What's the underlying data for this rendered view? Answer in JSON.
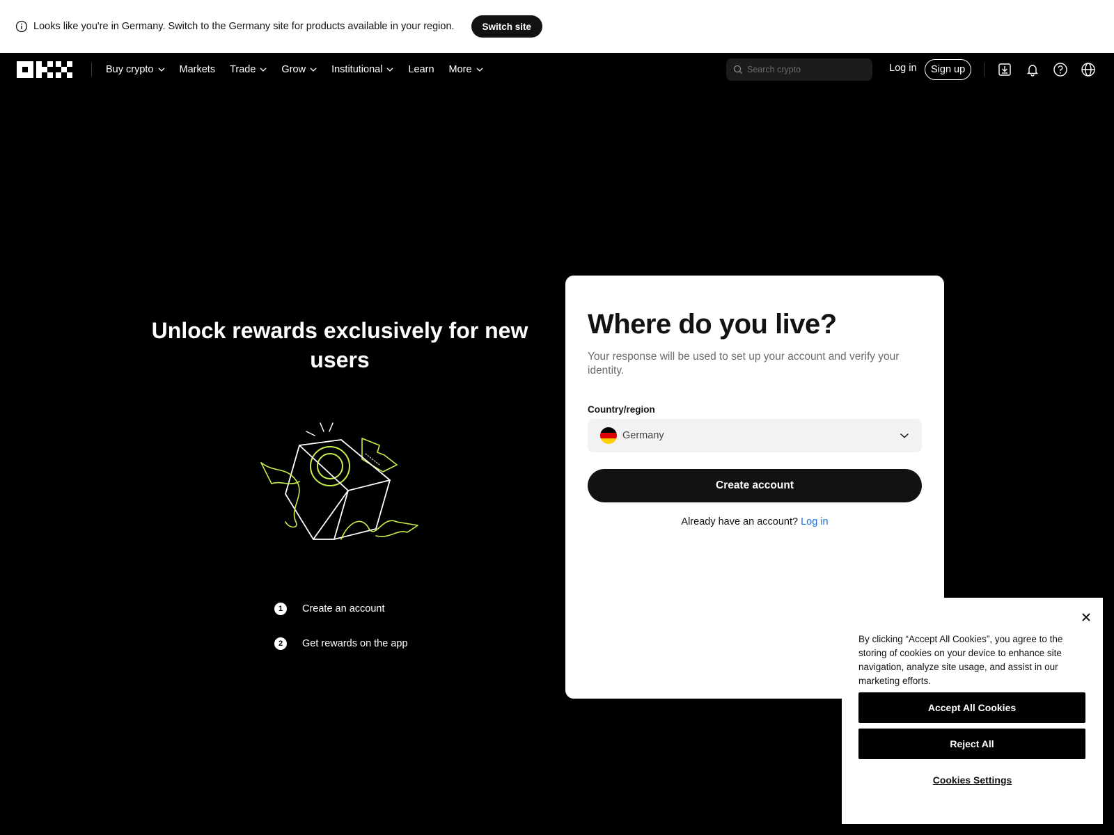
{
  "banner": {
    "message": "Looks like you're in Germany. Switch to the Germany site for products available in your region.",
    "switch_label": "Switch site",
    "icon": "info-icon"
  },
  "nav": {
    "links": [
      {
        "label": "Buy crypto",
        "dropdown": true
      },
      {
        "label": "Markets",
        "dropdown": false
      },
      {
        "label": "Trade",
        "dropdown": true
      },
      {
        "label": "Grow",
        "dropdown": true
      },
      {
        "label": "Institutional",
        "dropdown": true
      },
      {
        "label": "Learn",
        "dropdown": false
      },
      {
        "label": "More",
        "dropdown": true
      }
    ],
    "search_placeholder": "Search crypto",
    "login_label": "Log in",
    "signup_label": "Sign up",
    "icons": [
      "download-icon",
      "bell-icon",
      "help-icon",
      "globe-icon"
    ]
  },
  "hero": {
    "title": "Unlock rewards exclusively for new users",
    "steps": [
      {
        "num": "1",
        "text": "Create an account"
      },
      {
        "num": "2",
        "text": "Get rewards on the app"
      }
    ],
    "accent_color": "#c8f04a"
  },
  "card": {
    "title": "Where do you live?",
    "subtitle": "Your response will be used to set up your account and verify your identity.",
    "field_label": "Country/region",
    "selected_country": "Germany",
    "create_label": "Create account",
    "already_text": "Already have an account?",
    "login_link": "Log in",
    "link_color": "#1a6fe0"
  },
  "cookie": {
    "text": "By clicking “Accept All Cookies”, you agree to the storing of cookies on your device to enhance site navigation, analyze site usage, and assist in our marketing efforts.",
    "accept_label": "Accept All Cookies",
    "reject_label": "Reject All",
    "settings_label": "Cookies Settings"
  }
}
